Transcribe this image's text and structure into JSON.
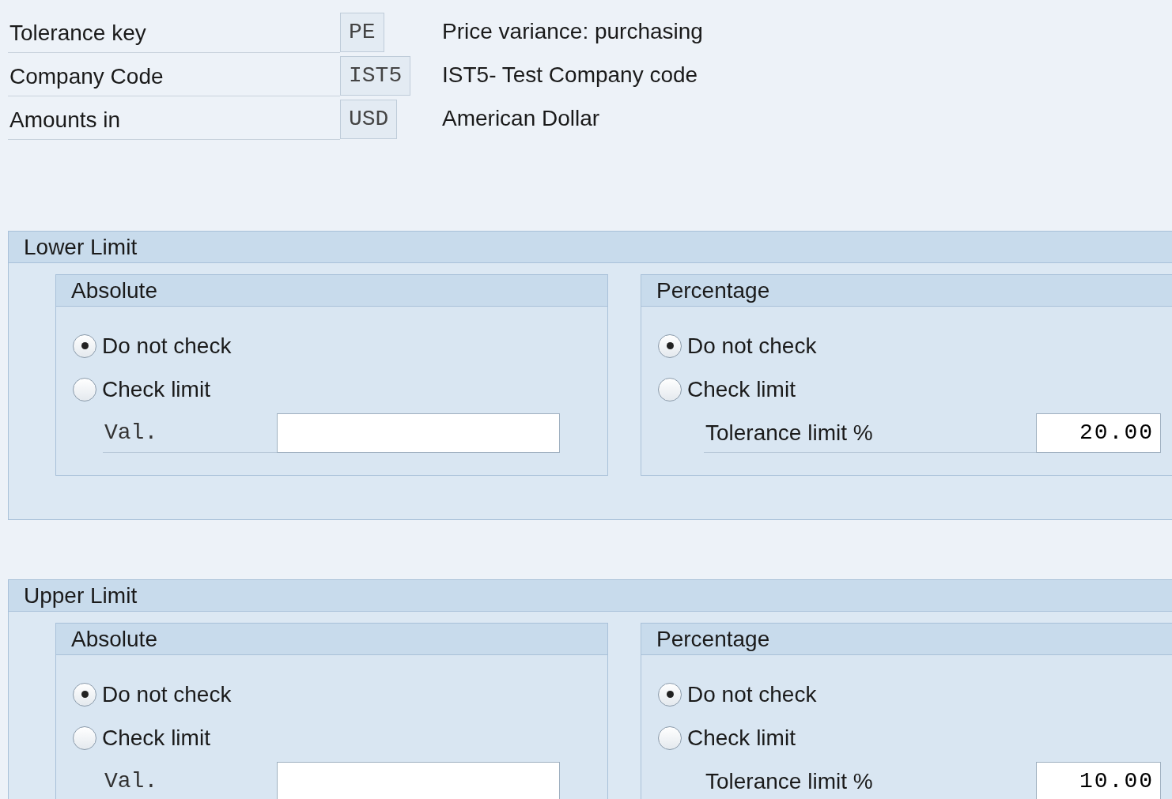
{
  "header_fields": [
    {
      "label": "Tolerance key",
      "value": "PE",
      "description": "Price variance: purchasing"
    },
    {
      "label": "Company Code",
      "value": "IST5",
      "description": "IST5- Test Company code"
    },
    {
      "label": "Amounts in",
      "value": "USD",
      "description": "American Dollar"
    }
  ],
  "groups": [
    {
      "title": "Lower Limit",
      "subgroups": [
        {
          "title": "Absolute",
          "options": [
            {
              "label": "Do not check",
              "selected": true
            },
            {
              "label": "Check limit",
              "selected": false
            }
          ],
          "field": {
            "kind": "amount",
            "label": "Val."
          }
        },
        {
          "title": "Percentage",
          "options": [
            {
              "label": "Do not check",
              "selected": true
            },
            {
              "label": "Check limit",
              "selected": false
            }
          ],
          "field": {
            "kind": "percent",
            "label": "Tolerance limit %",
            "value": "20.00"
          }
        }
      ]
    },
    {
      "title": "Upper Limit",
      "subgroups": [
        {
          "title": "Absolute",
          "options": [
            {
              "label": "Do not check",
              "selected": true
            },
            {
              "label": "Check limit",
              "selected": false
            }
          ],
          "field": {
            "kind": "amount",
            "label": "Val."
          }
        },
        {
          "title": "Percentage",
          "options": [
            {
              "label": "Do not check",
              "selected": true
            },
            {
              "label": "Check limit",
              "selected": false
            }
          ],
          "field": {
            "kind": "percent",
            "label": "Tolerance limit %",
            "value": "10.00"
          }
        }
      ]
    }
  ]
}
